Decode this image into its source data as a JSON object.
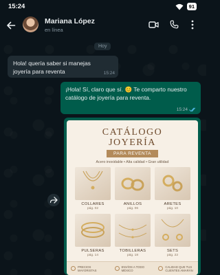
{
  "status_bar": {
    "time": "15:24",
    "battery": "91"
  },
  "header": {
    "name": "Mariana López",
    "status": "en línea"
  },
  "chat": {
    "date_label": "Hoy",
    "messages": [
      {
        "text": "Hola! quería saber si manejas joyería para reventa",
        "time": "15:24"
      },
      {
        "text": "¡Hola! Sí, claro que sí. 😊 Te comparto nuestro catálogo de joyería para reventa.",
        "time": "15:24"
      }
    ]
  },
  "catalog": {
    "title_line1": "CATÁLOGO",
    "title_line2": "JOYERÍA",
    "banner": "PARA REVENTA",
    "tagline": "Acero inoxidable • Alta calidad • Gran utilidad",
    "items": [
      {
        "name": "COLLARES",
        "page": "pág. 02"
      },
      {
        "name": "ANILLOS",
        "page": "pág. 06"
      },
      {
        "name": "ARETES",
        "page": "pág. 10"
      },
      {
        "name": "PULSERAS",
        "page": "pág. 14"
      },
      {
        "name": "TOBILLERAS",
        "page": "pág. 18"
      },
      {
        "name": "SETS",
        "page": "pág. 22"
      }
    ],
    "footer": [
      "PRECIOS MAYORISTAS",
      "ENVÍOS A TODO MÉXICO",
      "CALIDAD QUE TUS CLIENTES AMARÁN"
    ]
  },
  "colors": {
    "incoming": "#202c33",
    "outgoing": "#005c4b",
    "accent": "#b38a5a"
  }
}
